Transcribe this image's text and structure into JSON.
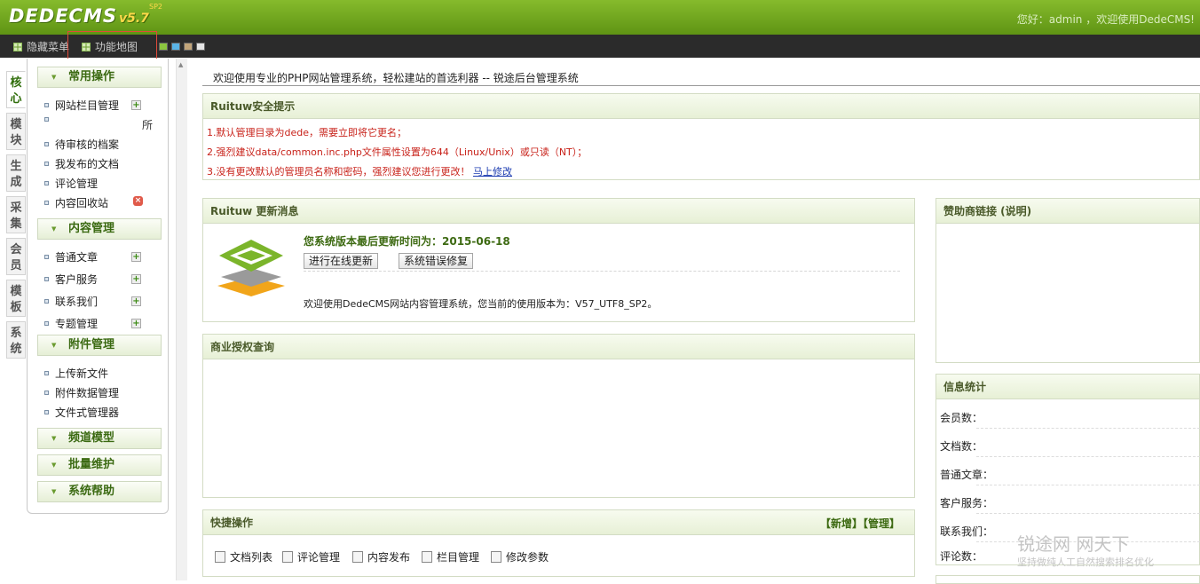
{
  "header": {
    "logo_brand": "DEDECMS",
    "logo_version": "v5.7",
    "logo_sup": "SP2",
    "greeting": "您好：admin ，欢迎使用DedeCMS!"
  },
  "toolbar": {
    "hide_menu": "隐藏菜单",
    "function_map": "功能地图"
  },
  "side_tabs": [
    "核心",
    "模块",
    "生成",
    "采集",
    "会员",
    "模板",
    "系统"
  ],
  "menu": {
    "common_ops": "常用操作",
    "site_columns": "网站栏目管理",
    "all_label": "所",
    "pending_docs": "待审核的档案",
    "my_docs": "我发布的文档",
    "comments": "评论管理",
    "recycle_bin": "内容回收站",
    "content_mgmt": "内容管理",
    "normal_articles": "普通文章",
    "customer_service": "客户服务",
    "contact_us": "联系我们",
    "special_topics": "专题管理",
    "attachment_mgmt": "附件管理",
    "upload_file": "上传新文件",
    "attachment_data": "附件数据管理",
    "file_manager": "文件式管理器",
    "channel_model": "频道模型",
    "batch_maintain": "批量维护",
    "system_help": "系统帮助"
  },
  "main": {
    "welcome": "欢迎使用专业的PHP网站管理系统，轻松建站的首选利器 -- 锐途后台管理系统",
    "security": {
      "title": "Ruituw安全提示",
      "line1": "1.默认管理目录为dede，需要立即将它更名；",
      "line2": "2.强烈建议data/common.inc.php文件属性设置为644（Linux/Unix）或只读（NT）；",
      "line3": "3.没有更改默认的管理员名称和密码，强烈建议您进行更改！",
      "line3_link": "马上修改"
    },
    "update": {
      "title": "Ruituw 更新消息",
      "last_update": "您系统版本最后更新时间为：2015-06-18",
      "btn_online_update": "进行在线更新",
      "btn_fix": "系统错误修复",
      "version_text": "欢迎使用DedeCMS网站内容管理系统，您当前的使用版本为：V57_UTF8_SP2。"
    },
    "license": {
      "title": "商业授权查询"
    },
    "quick": {
      "title": "快捷操作",
      "add": "【新增】",
      "manage": "【管理】",
      "links": [
        "文档列表",
        "评论管理",
        "内容发布",
        "栏目管理",
        "修改参数"
      ]
    },
    "sponsor": {
      "title": "赞助商链接 (说明)"
    },
    "stats": {
      "title": "信息统计",
      "rows": [
        "会员数：",
        "文档数：",
        "普通文章：",
        "客户服务：",
        "联系我们：",
        "评论数："
      ]
    }
  },
  "watermark": {
    "line1": "锐途网  网天下",
    "line2": "坚持做纯人工自然搜索排名优化"
  }
}
